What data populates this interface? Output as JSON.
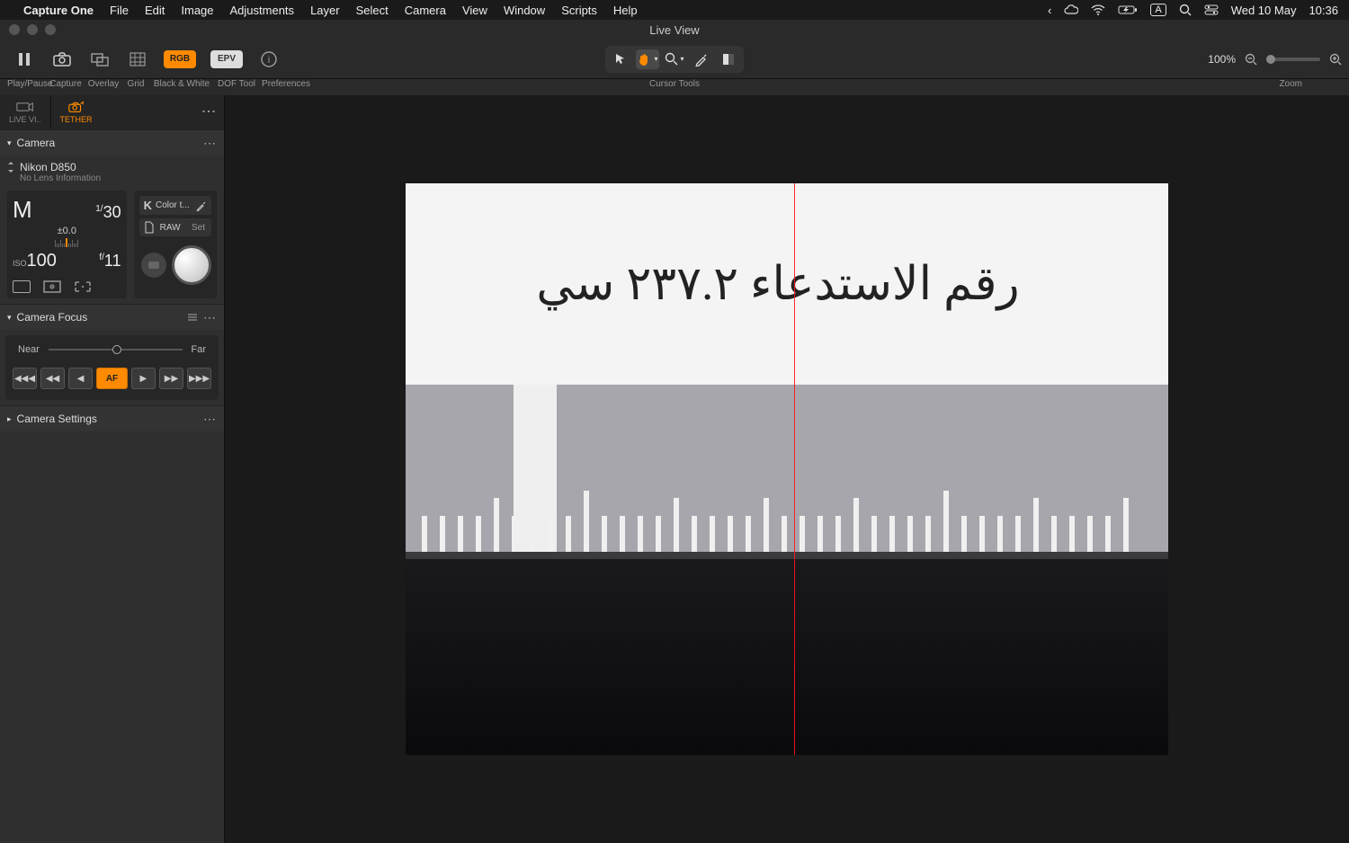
{
  "menubar": {
    "app": "Capture One",
    "items": [
      "File",
      "Edit",
      "Image",
      "Adjustments",
      "Layer",
      "Select",
      "Camera",
      "View",
      "Window",
      "Scripts",
      "Help"
    ],
    "status": {
      "input_mode": "A",
      "date": "Wed 10 May",
      "time": "10:36"
    }
  },
  "window": {
    "title": "Live View"
  },
  "toolbar": {
    "play_pause": "Play/Pause",
    "capture": "Capture",
    "overlay": "Overlay",
    "grid": "Grid",
    "bw": "Black & White",
    "rgb_chip": "RGB",
    "epv_chip": "EPV",
    "dof": "DOF Tool",
    "prefs": "Preferences",
    "cursor_tools": "Cursor Tools",
    "zoom_label": "Zoom",
    "zoom_value": "100%"
  },
  "sidebar": {
    "tabs": {
      "live": "LIVE VI..",
      "tether": "TETHER"
    },
    "camera": {
      "header": "Camera",
      "name": "Nikon D850",
      "lens": "No Lens Information",
      "mode": "M",
      "shutter_num": "1/",
      "shutter_den": "30",
      "ev": "±0.0",
      "iso_label": "ISO",
      "iso": "100",
      "aperture_f": "f/",
      "aperture": "11",
      "kelvin": "K",
      "wb_label": "Color t...",
      "format": "RAW",
      "set": "Set"
    },
    "focus": {
      "header": "Camera Focus",
      "near": "Near",
      "far": "Far",
      "af": "AF"
    },
    "settings": {
      "header": "Camera Settings"
    }
  },
  "live_image": {
    "arabic_text": "رقم الاستدعاء ٢٣٧.٢ سي"
  }
}
